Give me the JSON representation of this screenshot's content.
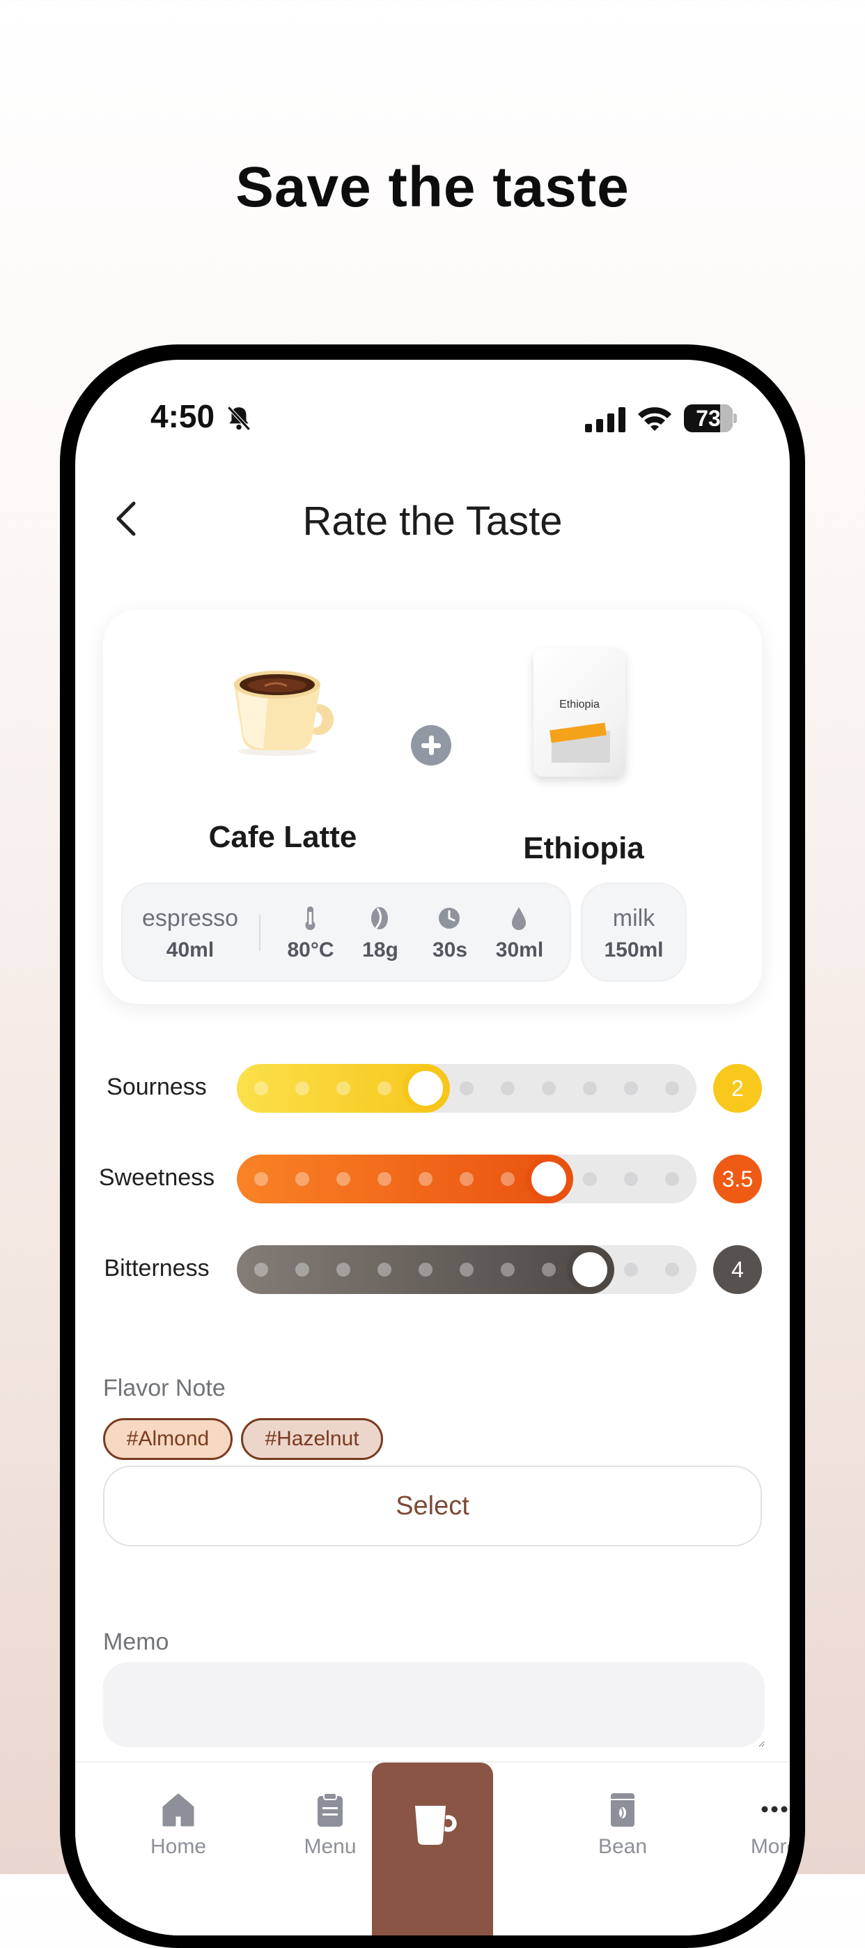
{
  "headline": "Save the taste",
  "status": {
    "time": "4:50",
    "battery": "73"
  },
  "header": {
    "title": "Rate the Taste"
  },
  "drink": {
    "name": "Cafe Latte"
  },
  "bean": {
    "name": "Ethiopia",
    "bag_label": "Ethiopia"
  },
  "recipe": {
    "espresso_label": "espresso",
    "espresso_value": "40ml",
    "temperature": "80°C",
    "dose": "18g",
    "time": "30s",
    "water": "30ml",
    "milk_label": "milk",
    "milk_value": "150ml"
  },
  "ratings": [
    {
      "label": "Sourness",
      "value": "2",
      "level": 2,
      "max": 5,
      "color": "#f8c91c"
    },
    {
      "label": "Sweetness",
      "value": "3.5",
      "level": 3.5,
      "max": 5,
      "color": "#ef5b14"
    },
    {
      "label": "Bitterness",
      "value": "4",
      "level": 4,
      "max": 5,
      "color": "#57524e"
    }
  ],
  "flavor": {
    "label": "Flavor Note",
    "tags": [
      "#Almond",
      "#Hazelnut"
    ],
    "select_label": "Select"
  },
  "memo": {
    "label": "Memo",
    "placeholder": ""
  },
  "tabs": [
    {
      "label": "Home",
      "icon": "home-icon"
    },
    {
      "label": "Menu",
      "icon": "clipboard-icon"
    },
    {
      "label": "",
      "icon": "coffee-cup-icon"
    },
    {
      "label": "Bean",
      "icon": "bean-bag-icon"
    },
    {
      "label": "More",
      "icon": "more-dots-icon"
    }
  ]
}
